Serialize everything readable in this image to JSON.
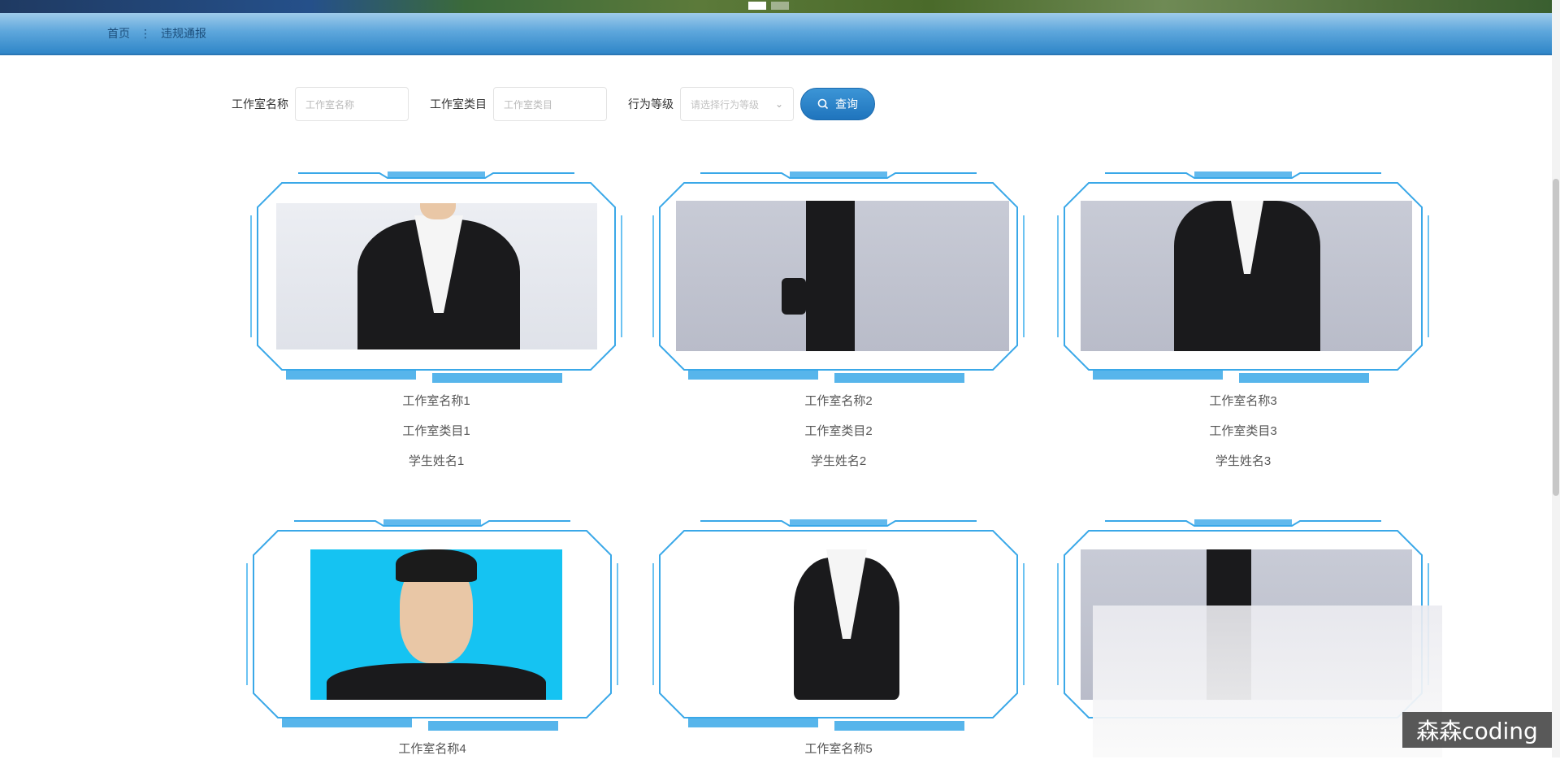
{
  "breadcrumb": {
    "home": "首页",
    "separator": "⋮",
    "current": "违规通报"
  },
  "search": {
    "fields": [
      {
        "label": "工作室名称",
        "placeholder": "工作室名称"
      },
      {
        "label": "工作室类目",
        "placeholder": "工作室类目"
      }
    ],
    "level": {
      "label": "行为等级",
      "placeholder": "请选择行为等级"
    },
    "button_label": "查询"
  },
  "cards": [
    {
      "name": "工作室名称1",
      "category": "工作室类目1",
      "student": "学生姓名1"
    },
    {
      "name": "工作室名称2",
      "category": "工作室类目2",
      "student": "学生姓名2"
    },
    {
      "name": "工作室名称3",
      "category": "工作室类目3",
      "student": "学生姓名3"
    },
    {
      "name": "工作室名称4",
      "category": "",
      "student": ""
    },
    {
      "name": "工作室名称5",
      "category": "",
      "student": ""
    }
  ],
  "watermark": "森森coding",
  "colors": {
    "accent": "#2f86c8",
    "frame": "#3aa8e8"
  }
}
